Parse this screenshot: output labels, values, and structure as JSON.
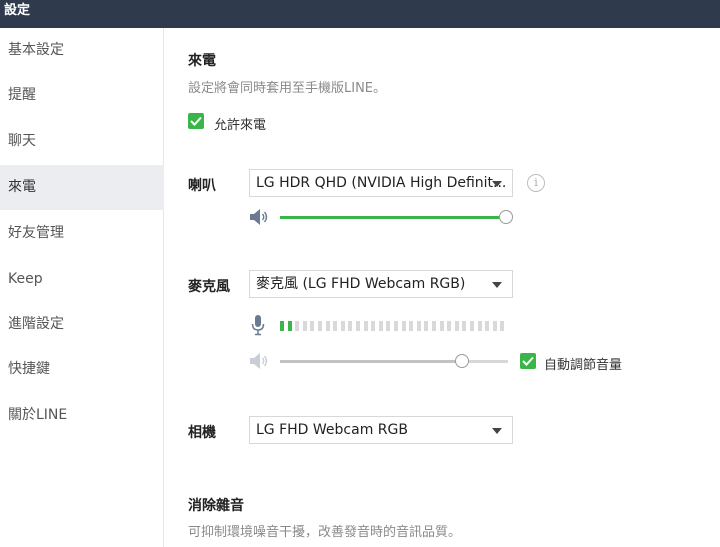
{
  "window": {
    "title": "設定"
  },
  "sidebar": {
    "items": [
      {
        "label": "基本設定",
        "active": false
      },
      {
        "label": "提醒",
        "active": false
      },
      {
        "label": "聊天",
        "active": false
      },
      {
        "label": "來電",
        "active": true
      },
      {
        "label": "好友管理",
        "active": false
      },
      {
        "label": "Keep",
        "active": false
      },
      {
        "label": "進階設定",
        "active": false
      },
      {
        "label": "快捷鍵",
        "active": false
      },
      {
        "label": "關於LINE",
        "active": false
      }
    ]
  },
  "calls": {
    "title": "來電",
    "description": "設定將會同時套用至手機版LINE。",
    "allow_calls_label": "允許來電",
    "allow_calls_checked": true
  },
  "speaker": {
    "label": "喇叭",
    "device": "LG HDR QHD (NVIDIA High Definit...",
    "volume": 1.0
  },
  "microphone": {
    "label": "麥克風",
    "device": "麥克風 (LG FHD Webcam RGB)",
    "level_active_bars": 2,
    "level_total_bars": 30,
    "volume": 0.8,
    "auto_adjust_label": "自動調節音量",
    "auto_adjust_checked": true
  },
  "camera": {
    "label": "相機",
    "device": "LG FHD Webcam RGB"
  },
  "noise": {
    "title": "消除雜音",
    "description": "可抑制環境噪音干擾，改善發音時的音訊品質。"
  },
  "colors": {
    "accent": "#3ab54a",
    "titlebar": "#2f3a4d",
    "active_nav": "#ecedf1"
  }
}
